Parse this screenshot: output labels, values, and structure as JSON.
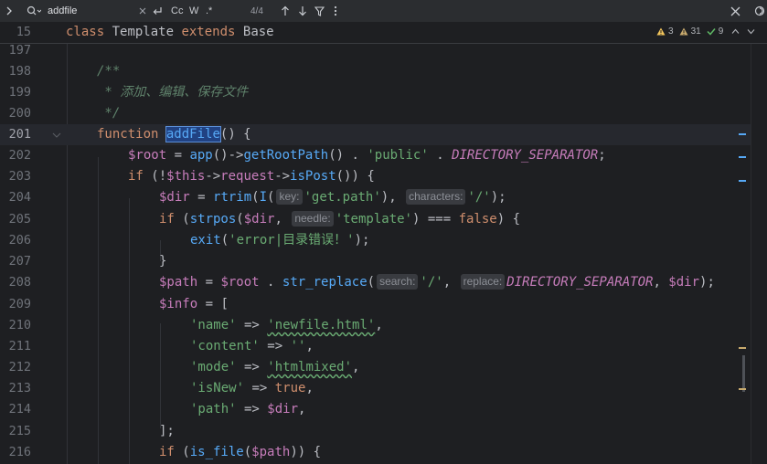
{
  "findbar": {
    "query": "addfile",
    "match_count": "4/4",
    "case_label": "Cc",
    "word_label": "W",
    "regex_label": ".*"
  },
  "inspections": {
    "warnings": "3",
    "weak_warnings": "31",
    "ok": "9"
  },
  "sticky": {
    "line_number": "15",
    "code": {
      "kw1": "class",
      "name": " Template ",
      "kw2": "extends",
      "base": " Base"
    }
  },
  "lines": [
    {
      "n": "197"
    },
    {
      "n": "198",
      "doc": "/**"
    },
    {
      "n": "199",
      "doc": " * 添加、编辑、保存文件"
    },
    {
      "n": "200",
      "doc": " */"
    },
    {
      "n": "201"
    },
    {
      "n": "202"
    },
    {
      "n": "203"
    },
    {
      "n": "204"
    },
    {
      "n": "205"
    },
    {
      "n": "206"
    },
    {
      "n": "207"
    },
    {
      "n": "208"
    },
    {
      "n": "209"
    },
    {
      "n": "210"
    },
    {
      "n": "211"
    },
    {
      "n": "212"
    },
    {
      "n": "213"
    },
    {
      "n": "214"
    },
    {
      "n": "215"
    },
    {
      "n": "216"
    }
  ],
  "code": {
    "l201": {
      "kw": "function",
      "match": "addFile",
      "rest": "() {"
    },
    "l202": {
      "v1": "$root",
      "eq": " = ",
      "fn1": "app",
      "p1": "()->",
      "fn2": "getRootPath",
      "p2": "() . ",
      "s1": "'public'",
      "p3": " . ",
      "c1": "DIRECTORY_SEPARATOR",
      "p4": ";"
    },
    "l203": {
      "kw": "if",
      "p1": " (!",
      "t": "$this",
      "p2": "->",
      "m1": "request",
      "p3": "->",
      "fn": "isPost",
      "p4": "()) {"
    },
    "l204": {
      "v": "$dir",
      "eq": " = ",
      "fn1": "rtrim",
      "p1": "(",
      "fn2": "I",
      "p2": "(",
      "h1": "key:",
      "s1": "'get.path'",
      "p3": "), ",
      "h2": "characters:",
      "s2": "'/'",
      "p4": ");"
    },
    "l205": {
      "kw": "if",
      "p1": " (",
      "fn": "strpos",
      "p2": "(",
      "v": "$dir",
      "p3": ", ",
      "h1": "needle:",
      "s1": "'template'",
      "p4": ") === ",
      "b": "false",
      "p5": ") {"
    },
    "l206": {
      "fn": "exit",
      "p1": "(",
      "s1": "'error|目录错误！'",
      "p2": ");"
    },
    "l207": {
      "p": "}"
    },
    "l208": {
      "v1": "$path",
      "eq": " = ",
      "v2": "$root",
      "p1": " . ",
      "fn": "str_replace",
      "p2": "(",
      "h1": "search:",
      "s1": "'/'",
      "p3": ", ",
      "h2": "replace:",
      "c1": "DIRECTORY_SEPARATOR",
      "p4": ", ",
      "v3": "$dir",
      "p5": ");"
    },
    "l209": {
      "v": "$info",
      "p": " = ["
    },
    "l210": {
      "s1": "'name'",
      "p1": " => ",
      "s2": "'newfile.html'",
      "p2": ","
    },
    "l211": {
      "s1": "'content'",
      "p1": " => ",
      "s2": "''",
      "p2": ","
    },
    "l212": {
      "s1": "'mode'",
      "p1": " => ",
      "s2": "'htmlmixed'",
      "p2": ","
    },
    "l213": {
      "s1": "'isNew'",
      "p1": " => ",
      "b": "true",
      "p2": ","
    },
    "l214": {
      "s1": "'path'",
      "p1": " => ",
      "v": "$dir",
      "p2": ","
    },
    "l215": {
      "p": "];"
    },
    "l216": {
      "kw": "if",
      "p1": " (",
      "fn": "is_file",
      "p2": "(",
      "v": "$path",
      "p3": ")) {"
    }
  },
  "colors": {
    "background": "#1e1f22",
    "keyword": "#cf8e6d",
    "function": "#56a8f5",
    "string": "#6aab73",
    "variable": "#c77dbb",
    "doc_comment": "#5f826b",
    "match_highlight": "#214283"
  }
}
